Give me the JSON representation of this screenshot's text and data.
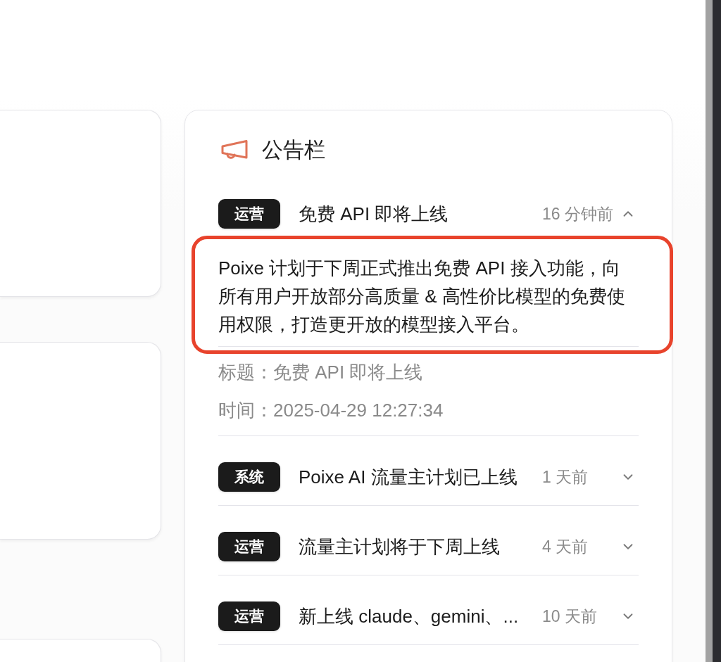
{
  "announcement_board": {
    "title": "公告栏",
    "items": [
      {
        "tag": "运营",
        "title": "免费 API 即将上线",
        "time": "16 分钟前",
        "expanded": true,
        "highlighted": true,
        "body": "Poixe 计划于下周正式推出免费 API 接入功能，向所有用户开放部分高质量 & 高性价比模型的免费使用权限，打造更开放的模型接入平台。",
        "details": [
          "标题：免费 API 即将上线",
          "时间：2025-04-29 12:27:34"
        ]
      },
      {
        "tag": "系统",
        "title": "Poixe AI 流量主计划已上线",
        "time": "1 天前",
        "expanded": false,
        "highlighted": false
      },
      {
        "tag": "运营",
        "title": "流量主计划将于下周上线",
        "time": "4 天前",
        "expanded": false,
        "highlighted": false
      },
      {
        "tag": "运营",
        "title": "新上线 claude、gemini、...",
        "time": "10 天前",
        "expanded": false,
        "highlighted": false
      }
    ]
  }
}
